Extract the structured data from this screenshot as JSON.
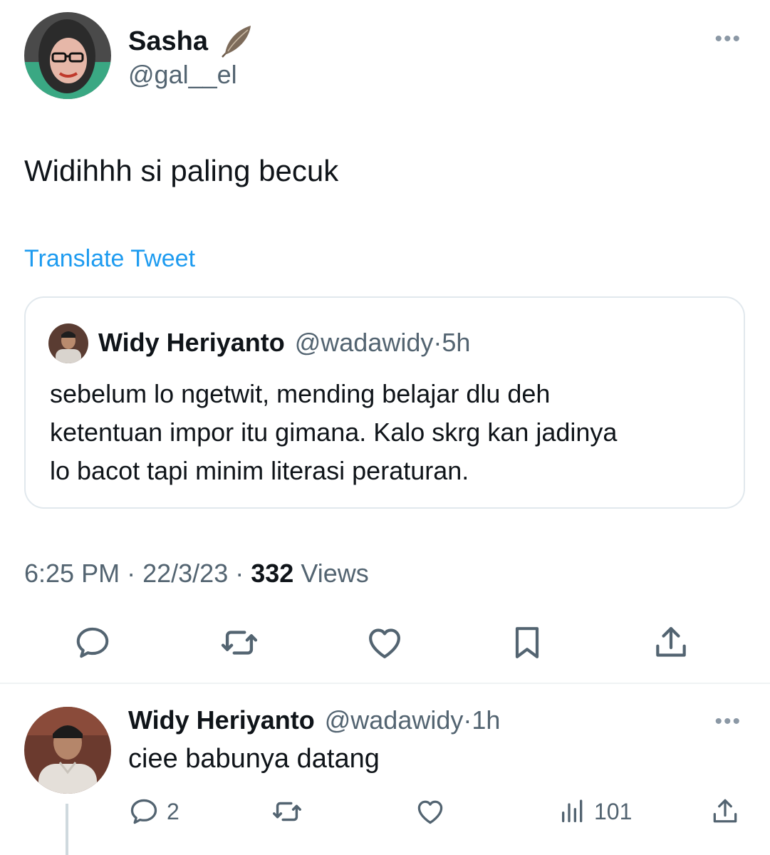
{
  "tweet": {
    "author_name": "Sasha",
    "author_handle": "@gal__el",
    "text": "Widihhh si paling becuk",
    "translate_label": "Translate Tweet",
    "more_label": "•••"
  },
  "quote": {
    "author_name": "Widy Heriyanto",
    "author_handle": "@wadawidy",
    "separator": "·",
    "time": "5h",
    "lines": [
      "sebelum lo ngetwit, mending belajar dlu deh",
      "ketentuan impor itu gimana. Kalo skrg kan jadinya",
      "lo bacot tapi minim literasi peraturan."
    ]
  },
  "meta": {
    "time": "6:25 PM",
    "separator": "·",
    "date": "22/3/23",
    "views_count": "332",
    "views_label": "Views"
  },
  "actions": {
    "icons": [
      "reply-icon",
      "retweet-icon",
      "like-icon",
      "bookmark-icon",
      "share-icon"
    ]
  },
  "reply": {
    "author_name": "Widy Heriyanto",
    "author_handle": "@wadawidy",
    "separator": "·",
    "time": "1h",
    "text": "ciee babunya datang",
    "more_label": "•••",
    "reply_count": "2",
    "views_count": "101"
  },
  "colors": {
    "primary_text": "#0f1419",
    "secondary_text": "#536471",
    "link": "#1d9bf0",
    "border": "#e1e8ed"
  }
}
